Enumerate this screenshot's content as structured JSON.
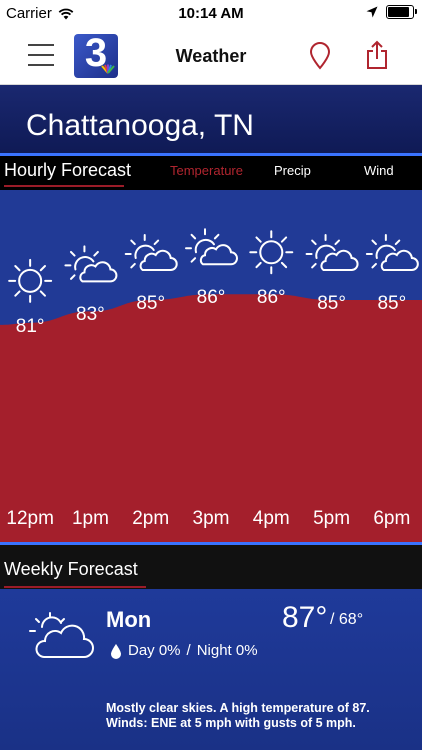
{
  "status_bar": {
    "carrier": "Carrier",
    "time": "10:14 AM",
    "battery_level": 0.95
  },
  "nav": {
    "title": "Weather",
    "logo_text": "3",
    "accent_color": "#b0252f"
  },
  "location": {
    "city": "Chattanooga, TN"
  },
  "hourly": {
    "title": "Hourly Forecast",
    "tabs": [
      {
        "label": "Temperature",
        "active": true
      },
      {
        "label": "Precip",
        "active": false
      },
      {
        "label": "Wind",
        "active": false
      }
    ],
    "hours": [
      {
        "time": "12pm",
        "temp": "81°",
        "value": 81,
        "icon": "sun-icon"
      },
      {
        "time": "1pm",
        "temp": "83°",
        "value": 83,
        "icon": "partly-cloudy-icon"
      },
      {
        "time": "2pm",
        "temp": "85°",
        "value": 85,
        "icon": "partly-cloudy-icon"
      },
      {
        "time": "3pm",
        "temp": "86°",
        "value": 86,
        "icon": "partly-cloudy-icon"
      },
      {
        "time": "4pm",
        "temp": "86°",
        "value": 86,
        "icon": "sun-icon"
      },
      {
        "time": "5pm",
        "temp": "85°",
        "value": 85,
        "icon": "partly-cloudy-icon"
      },
      {
        "time": "6pm",
        "temp": "85°",
        "value": 85,
        "icon": "partly-cloudy-icon"
      }
    ],
    "colors": {
      "fill": "#a41f2c",
      "background": "#213a96"
    }
  },
  "weekly": {
    "title": "Weekly Forecast",
    "days": [
      {
        "day": "Mon",
        "high": "87°",
        "low": "68°",
        "precip_day": "Day 0%",
        "precip_separator": "/",
        "precip_night": "Night 0%",
        "icon": "partly-cloudy-icon",
        "summary": "Mostly clear skies.  A high temperature of 87. Winds: ENE at 5 mph with gusts of 5 mph."
      }
    ]
  }
}
